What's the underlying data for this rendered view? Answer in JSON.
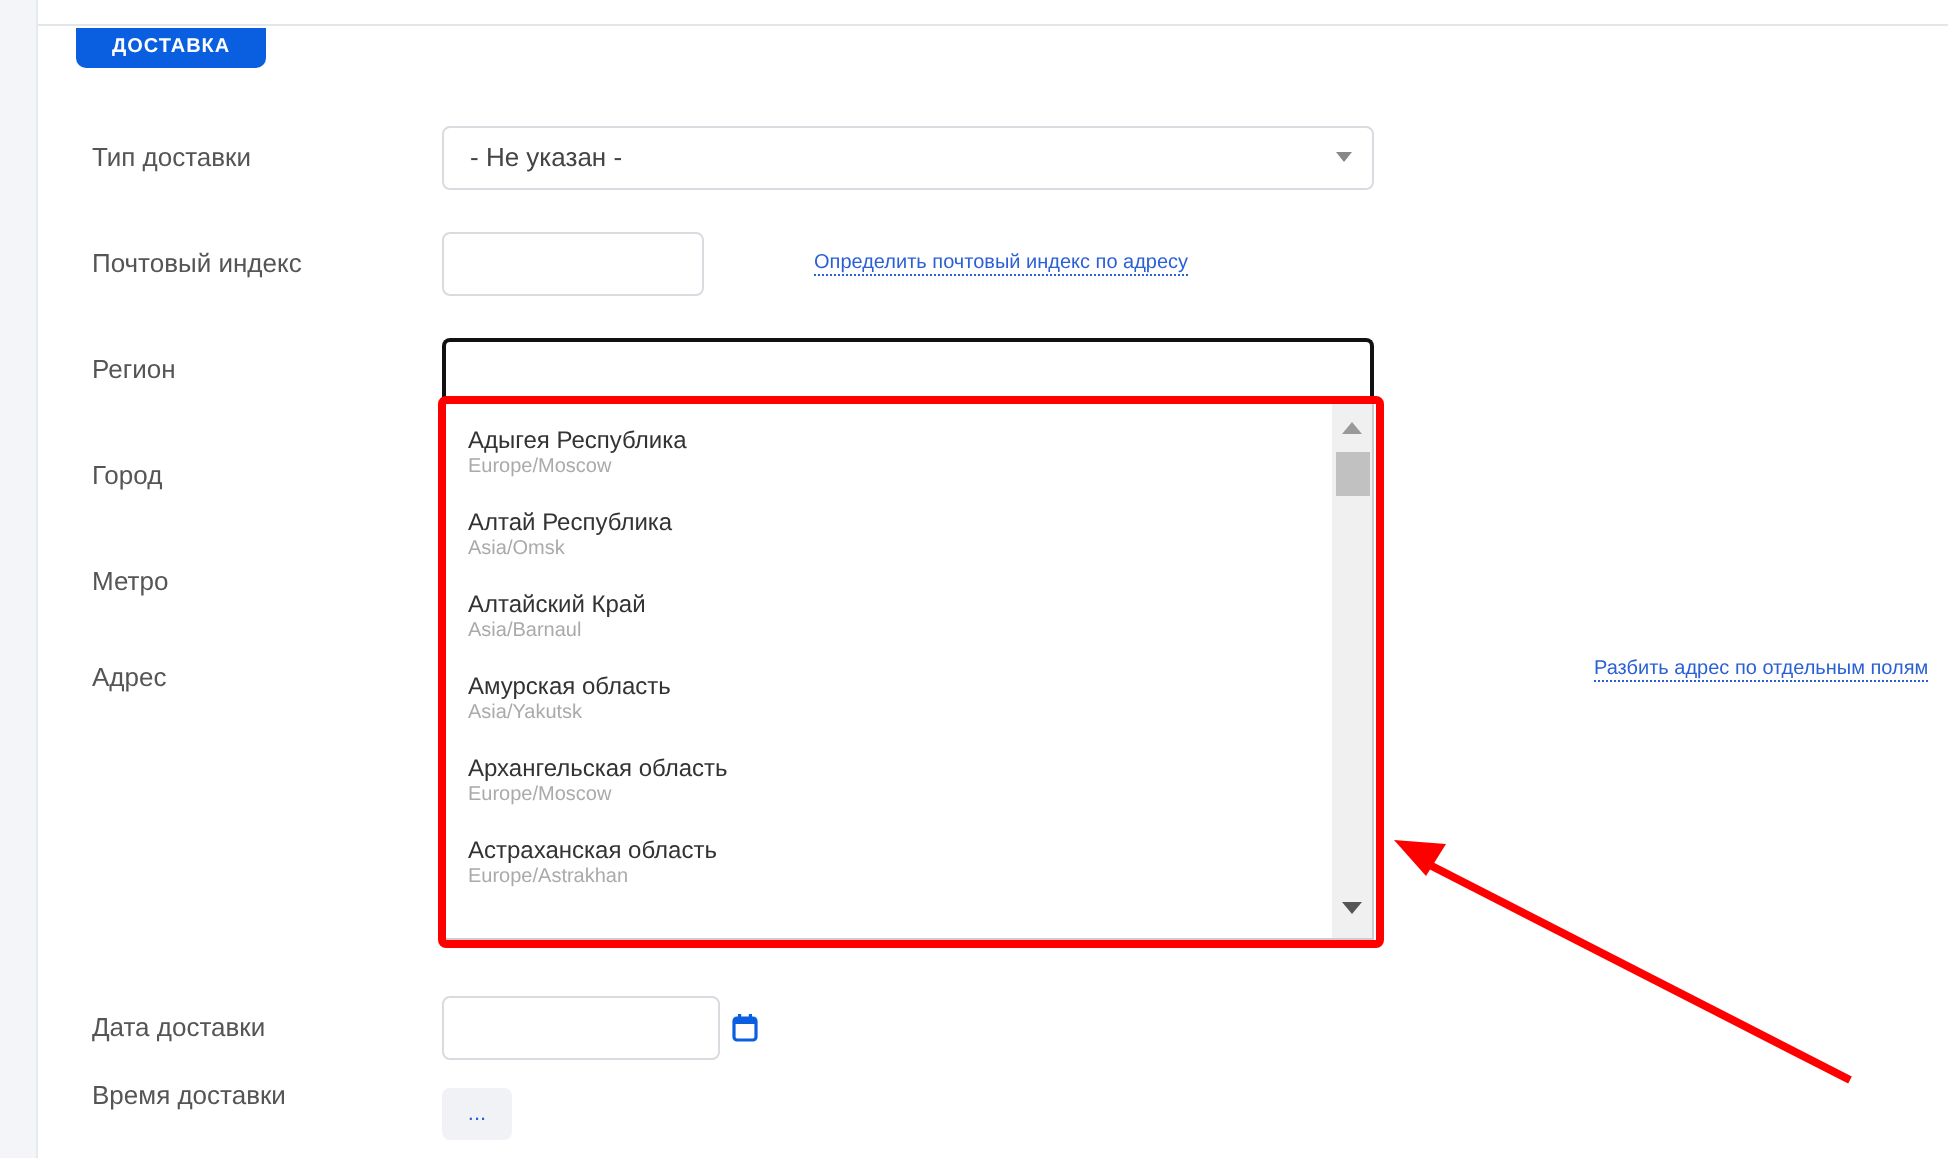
{
  "section_tab": {
    "label": "ДОСТАВКА"
  },
  "fields": [
    {
      "kind": "select",
      "label": "Тип доставки",
      "value": "- Не указан -"
    },
    {
      "kind": "text",
      "label": "Почтовый индекс",
      "link": "Определить почтовый индекс по адресу"
    },
    {
      "kind": "combobox",
      "label": "Регион",
      "expanded": true
    },
    {
      "kind": "covered",
      "label": "Город"
    },
    {
      "kind": "covered",
      "label": "Метро"
    },
    {
      "kind": "textarea",
      "label": "Адрес",
      "link": "Разбить адрес по отдельным полям"
    },
    {
      "kind": "date",
      "label": "Дата доставки"
    },
    {
      "kind": "time",
      "label": "Время доставки",
      "button": "..."
    }
  ],
  "region_options": [
    {
      "name": "Адыгея Республика",
      "timezone": "Europe/Moscow"
    },
    {
      "name": "Алтай Республика",
      "timezone": "Asia/Omsk"
    },
    {
      "name": "Алтайский Край",
      "timezone": "Asia/Barnaul"
    },
    {
      "name": "Амурская область",
      "timezone": "Asia/Yakutsk"
    },
    {
      "name": "Архангельская область",
      "timezone": "Europe/Moscow"
    },
    {
      "name": "Астраханская область",
      "timezone": "Europe/Astrakhan"
    }
  ]
}
